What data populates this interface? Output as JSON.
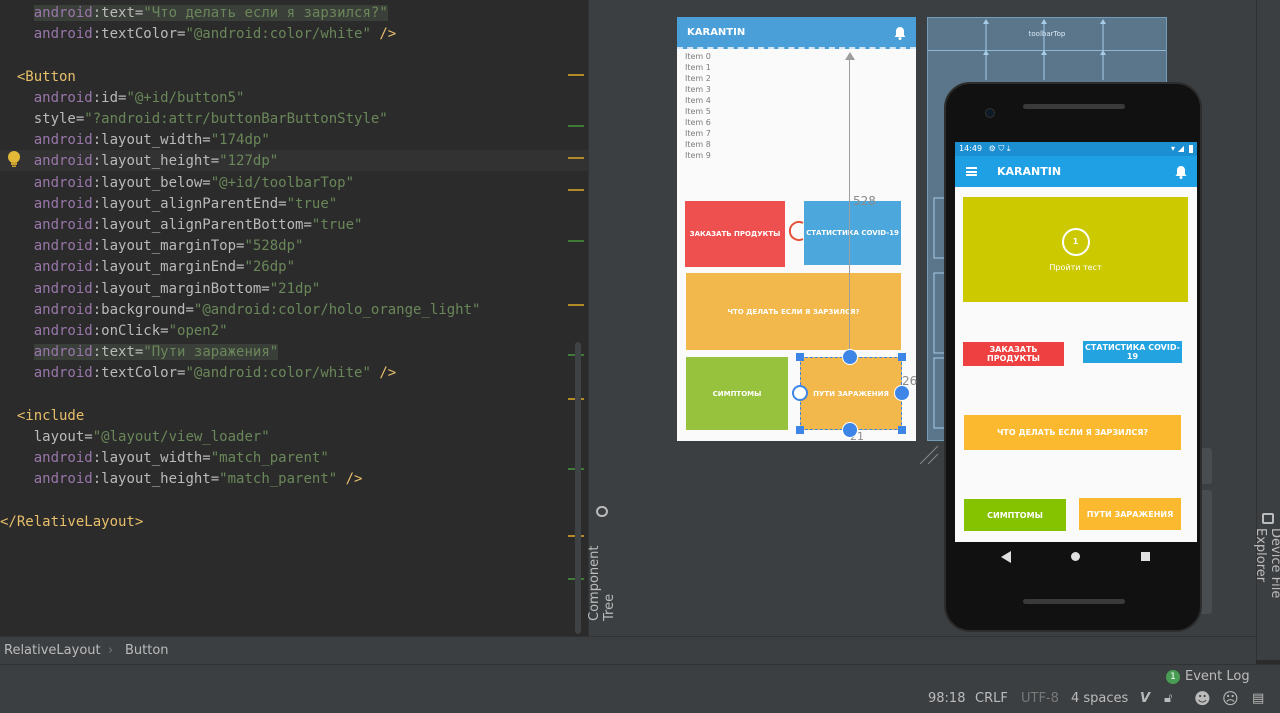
{
  "editor": {
    "lines": [
      {
        "ind": "    ",
        "parts": [
          [
            "ns",
            "android"
          ],
          [
            "at",
            ":text="
          ],
          [
            "v",
            "\"Что делать если я зарзился?\""
          ]
        ],
        "hl": true
      },
      {
        "ind": "    ",
        "parts": [
          [
            "ns",
            "android"
          ],
          [
            "at",
            ":textColor="
          ],
          [
            "v",
            "\"@android:color/white\""
          ],
          [
            "p",
            " />"
          ]
        ]
      },
      {
        "ind": "",
        "parts": []
      },
      {
        "ind": "  ",
        "parts": [
          [
            "t",
            "<Button"
          ]
        ]
      },
      {
        "ind": "    ",
        "parts": [
          [
            "ns",
            "android"
          ],
          [
            "at",
            ":id="
          ],
          [
            "v",
            "\"@+id/button5\""
          ]
        ]
      },
      {
        "ind": "    ",
        "parts": [
          [
            "at",
            "style="
          ],
          [
            "v",
            "\"?android:attr/buttonBarButtonStyle\""
          ]
        ]
      },
      {
        "ind": "    ",
        "parts": [
          [
            "ns",
            "android"
          ],
          [
            "at",
            ":layout_width="
          ],
          [
            "v",
            "\"174dp\""
          ]
        ]
      },
      {
        "ind": "    ",
        "parts": [
          [
            "ns",
            "android"
          ],
          [
            "at",
            ":layout_height="
          ],
          [
            "v",
            "\"127dp\""
          ]
        ]
      },
      {
        "ind": "    ",
        "parts": [
          [
            "ns",
            "android"
          ],
          [
            "at",
            ":layout_below="
          ],
          [
            "v",
            "\"@+id/toolbarTop\""
          ]
        ]
      },
      {
        "ind": "    ",
        "parts": [
          [
            "ns",
            "android"
          ],
          [
            "at",
            ":layout_alignParentEnd="
          ],
          [
            "v",
            "\"true\""
          ]
        ]
      },
      {
        "ind": "    ",
        "parts": [
          [
            "ns",
            "android"
          ],
          [
            "at",
            ":layout_alignParentBottom="
          ],
          [
            "v",
            "\"true\""
          ]
        ]
      },
      {
        "ind": "    ",
        "parts": [
          [
            "ns",
            "android"
          ],
          [
            "at",
            ":layout_marginTop="
          ],
          [
            "v",
            "\"528dp\""
          ]
        ]
      },
      {
        "ind": "    ",
        "parts": [
          [
            "ns",
            "android"
          ],
          [
            "at",
            ":layout_marginEnd="
          ],
          [
            "v",
            "\"26dp\""
          ]
        ]
      },
      {
        "ind": "    ",
        "parts": [
          [
            "ns",
            "android"
          ],
          [
            "at",
            ":layout_marginBottom="
          ],
          [
            "v",
            "\"21dp\""
          ]
        ]
      },
      {
        "ind": "    ",
        "parts": [
          [
            "ns",
            "android"
          ],
          [
            "at",
            ":background="
          ],
          [
            "v",
            "\"@android:color/holo_orange_light\""
          ]
        ]
      },
      {
        "ind": "    ",
        "parts": [
          [
            "ns",
            "android"
          ],
          [
            "at",
            ":onClick="
          ],
          [
            "v",
            "\"open2\""
          ]
        ]
      },
      {
        "ind": "    ",
        "parts": [
          [
            "ns",
            "android"
          ],
          [
            "at",
            ":text="
          ],
          [
            "v",
            "\"Пути заражения\""
          ]
        ],
        "hl": true
      },
      {
        "ind": "    ",
        "parts": [
          [
            "ns",
            "android"
          ],
          [
            "at",
            ":textColor="
          ],
          [
            "v",
            "\"@android:color/white\""
          ],
          [
            "p",
            " />"
          ]
        ]
      },
      {
        "ind": "",
        "parts": []
      },
      {
        "ind": "  ",
        "parts": [
          [
            "t",
            "<include"
          ]
        ]
      },
      {
        "ind": "    ",
        "parts": [
          [
            "at",
            "layout="
          ],
          [
            "v",
            "\"@layout/view_loader\""
          ]
        ]
      },
      {
        "ind": "    ",
        "parts": [
          [
            "ns",
            "android"
          ],
          [
            "at",
            ":layout_width="
          ],
          [
            "v",
            "\"match_parent\""
          ]
        ]
      },
      {
        "ind": "    ",
        "parts": [
          [
            "ns",
            "android"
          ],
          [
            "at",
            ":layout_height="
          ],
          [
            "v",
            "\"match_parent\""
          ],
          [
            "p",
            " />"
          ]
        ]
      },
      {
        "ind": "",
        "parts": []
      },
      {
        "ind": "",
        "parts": [
          [
            "t",
            "</RelativeLayout>"
          ]
        ]
      }
    ]
  },
  "component_tree_label": "Component Tree",
  "device_file_explorer_label": "Device File Explorer",
  "blueprint": {
    "title": "KARANTIN",
    "items": [
      "Item 0",
      "Item 1",
      "Item 2",
      "Item 3",
      "Item 4",
      "Item 5",
      "Item 6",
      "Item 7",
      "Item 8",
      "Item 9"
    ],
    "btn_order": "ЗАКАЗАТЬ ПРОДУКТЫ",
    "btn_stats": "СТАТИСТИКА COVID-19",
    "btn_what": "ЧТО ДЕЛАТЬ ЕСЛИ Я ЗАРЗИЛСЯ?",
    "btn_symptoms": "СИМПТОМЫ",
    "btn_ways": "ПУТИ ЗАРАЖЕНИЯ",
    "margin_top": "528",
    "margin_end": "26",
    "margin_bottom": "21",
    "ghost_label": "toolbarTop"
  },
  "phone": {
    "time": "14:49",
    "title": "KARANTIN",
    "test_number": "1",
    "test_label": "Пройти тест",
    "btn_order": "ЗАКАЗАТЬ ПРОДУКТЫ",
    "btn_stats": "СТАТИСТИКА COVID-19",
    "btn_what": "ЧТО ДЕЛАТЬ ЕСЛИ Я ЗАРЗИЛСЯ?",
    "btn_symptoms": "СИМПТОМЫ",
    "btn_ways": "ПУТИ ЗАРАЖЕНИЯ"
  },
  "breadcrumb": [
    "RelativeLayout",
    "Button"
  ],
  "event_log": {
    "count": "1",
    "label": "Event Log"
  },
  "status": {
    "position": "98:18",
    "line_sep": "CRLF",
    "encoding": "UTF-8",
    "indent": "4 spaces"
  },
  "colors": {
    "red": "#ee4f4f",
    "blue": "#4ba7dc",
    "orange": "#f2b84b",
    "green": "#97c23d",
    "yellow": "#ccc900",
    "toolbar": "#1fa0e5"
  }
}
